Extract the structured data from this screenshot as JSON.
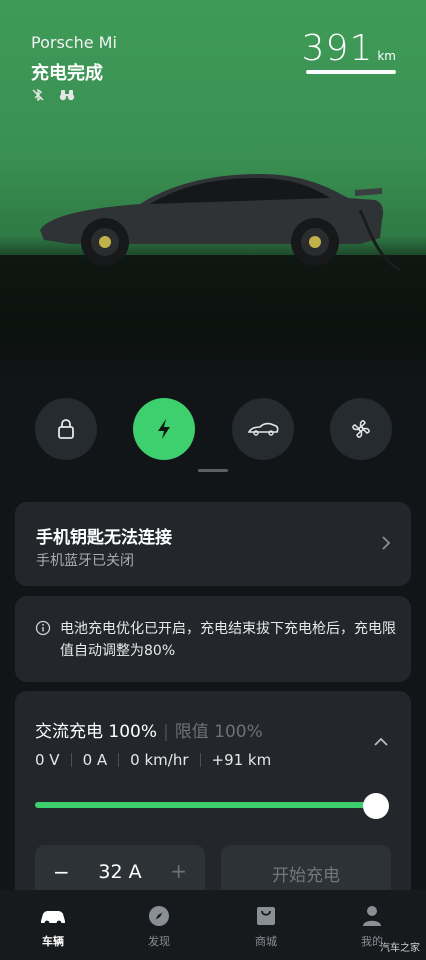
{
  "header": {
    "car_name": "Porsche Mi",
    "status": "充电完成",
    "range_value": "391",
    "range_unit": "km"
  },
  "quick_actions": [
    {
      "icon": "lock-icon",
      "active": false
    },
    {
      "icon": "lightning-icon",
      "active": true
    },
    {
      "icon": "car-trunk-icon",
      "active": false
    },
    {
      "icon": "fan-icon",
      "active": false
    }
  ],
  "phone_key_card": {
    "title": "手机钥匙无法连接",
    "subtitle": "手机蓝牙已关闭"
  },
  "notice": {
    "text": "电池充电优化已开启，充电结束拔下充电枪后，充电限值自动调整为80%"
  },
  "charging": {
    "mode_label": "交流充电 100%",
    "limit_label": "限值 100%",
    "voltage": "0 V",
    "current": "0 A",
    "speed": "0 km/hr",
    "added_range": "+91 km",
    "slider_level_percent": 100,
    "stepper_minus": "−",
    "stepper_value": "32 A",
    "stepper_plus": "+",
    "start_button": "开始充电"
  },
  "tabbar": [
    {
      "label": "车辆",
      "icon": "car-icon",
      "active": true
    },
    {
      "label": "发现",
      "icon": "compass-icon",
      "active": false
    },
    {
      "label": "商城",
      "icon": "shopping-bag-icon",
      "active": false
    },
    {
      "label": "我的",
      "icon": "person-icon",
      "active": false
    }
  ],
  "watermark": "汽车之家",
  "colors": {
    "accent": "#3ecf6e",
    "hero_green": "#3f9a57",
    "card_bg": "#23272c",
    "page_bg": "#121518"
  }
}
